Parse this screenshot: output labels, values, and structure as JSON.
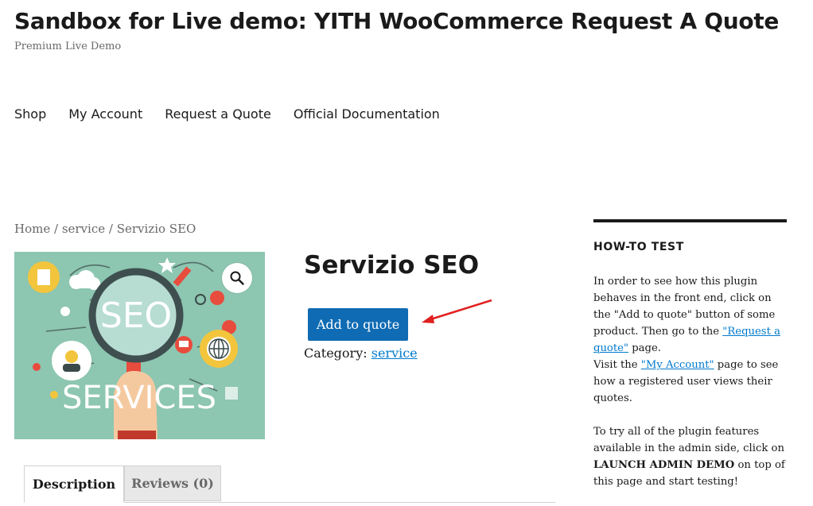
{
  "site": {
    "title": "Sandbox for Live demo: YITH WooCommerce Request A Quote",
    "description": "Premium Live Demo"
  },
  "nav": {
    "items": [
      {
        "label": "Shop"
      },
      {
        "label": "My Account"
      },
      {
        "label": "Request a Quote"
      },
      {
        "label": "Official Documentation"
      }
    ]
  },
  "breadcrumb": {
    "home": "Home",
    "sep1": " / ",
    "category": "service",
    "sep2": " / ",
    "current": "Servizio SEO"
  },
  "product": {
    "image_text_top": "SEO",
    "image_text_bottom": "SERVICES",
    "title": "Servizio SEO",
    "quote_button": "Add to quote",
    "category_label": "Category:",
    "category_value": "service"
  },
  "tabs": [
    {
      "label": "Description"
    },
    {
      "label": "Reviews (0)"
    }
  ],
  "sidebar": {
    "widget_title": "HOW-TO TEST",
    "p1_a": "In order to see how this plugin behaves in the front end, click on the \"Add to quote\" button of some product. Then go to the ",
    "p1_link1": "\"Request a quote\"",
    "p1_b": " page.",
    "p1_c": "Visit the ",
    "p1_link2": "\"My Account\"",
    "p1_d": " page to see how a registered user views their quotes.",
    "p2_a": "To try all of the plugin features available in the admin side, click on ",
    "p2_bold": "LAUNCH ADMIN DEMO",
    "p2_b": " on top of this page and start testing!"
  },
  "colors": {
    "button": "#0f6bb3",
    "link": "#007acc",
    "image_bg": "#8dc6b1",
    "arrow": "#e0201f"
  }
}
